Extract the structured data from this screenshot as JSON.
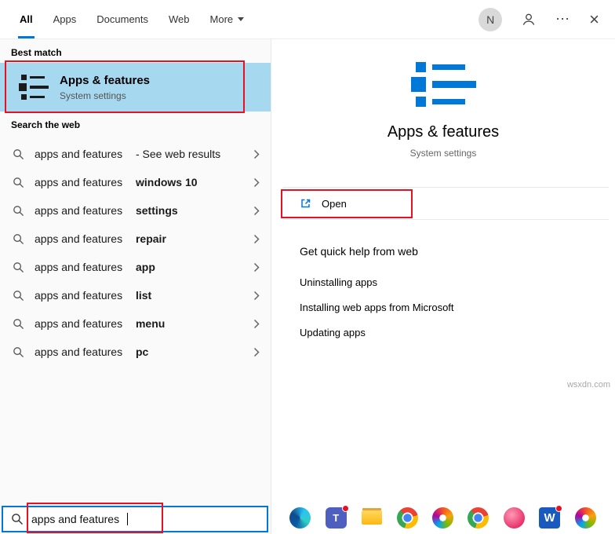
{
  "topbar": {
    "tabs": [
      {
        "label": "All",
        "active": true,
        "dropdown": false
      },
      {
        "label": "Apps",
        "active": false,
        "dropdown": false
      },
      {
        "label": "Documents",
        "active": false,
        "dropdown": false
      },
      {
        "label": "Web",
        "active": false,
        "dropdown": false
      },
      {
        "label": "More",
        "active": false,
        "dropdown": true
      }
    ],
    "avatar_letter": "N",
    "ellipsis": "⋯",
    "close": "×"
  },
  "left_panel": {
    "best_match_header": "Best match",
    "best_match": {
      "title": "Apps & features",
      "subtitle": "System settings"
    },
    "search_web_header": "Search the web",
    "suggestions": [
      {
        "typed": "apps and features",
        "completion": " - See web results",
        "bold": false
      },
      {
        "typed": "apps and features ",
        "completion": "windows 10",
        "bold": true
      },
      {
        "typed": "apps and features ",
        "completion": "settings",
        "bold": true
      },
      {
        "typed": "apps and features ",
        "completion": "repair",
        "bold": true
      },
      {
        "typed": "apps and features ",
        "completion": "app",
        "bold": true
      },
      {
        "typed": "apps and features ",
        "completion": "list",
        "bold": true
      },
      {
        "typed": "apps and features ",
        "completion": "menu",
        "bold": true
      },
      {
        "typed": "apps and features ",
        "completion": "pc",
        "bold": true
      }
    ],
    "search_box": {
      "value": "apps and features"
    }
  },
  "right_panel": {
    "app_title": "Apps & features",
    "app_subtitle": "System settings",
    "open_label": "Open",
    "help_header": "Get quick help from web",
    "help_links": [
      "Uninstalling apps",
      "Installing web apps from Microsoft",
      "Updating apps"
    ]
  },
  "taskbar": {
    "icons": [
      {
        "type": "edge",
        "name": "edge-icon"
      },
      {
        "type": "teams",
        "name": "teams-icon",
        "letter": "T",
        "badge": true
      },
      {
        "type": "folder",
        "name": "file-explorer-icon"
      },
      {
        "type": "chrome",
        "name": "chrome-icon"
      },
      {
        "type": "pinwheel",
        "name": "colorful-app-icon"
      },
      {
        "type": "chrome",
        "name": "chrome-icon"
      },
      {
        "type": "pink",
        "name": "pink-app-icon"
      },
      {
        "type": "word",
        "name": "word-icon",
        "letter": "W",
        "badge": true
      },
      {
        "type": "pinwheel",
        "name": "colorful-app-icon"
      }
    ]
  },
  "watermark": "wsxdn.com",
  "colors": {
    "accent": "#0078d7",
    "highlight": "#a6d8f0",
    "annotation": "#e81123"
  }
}
